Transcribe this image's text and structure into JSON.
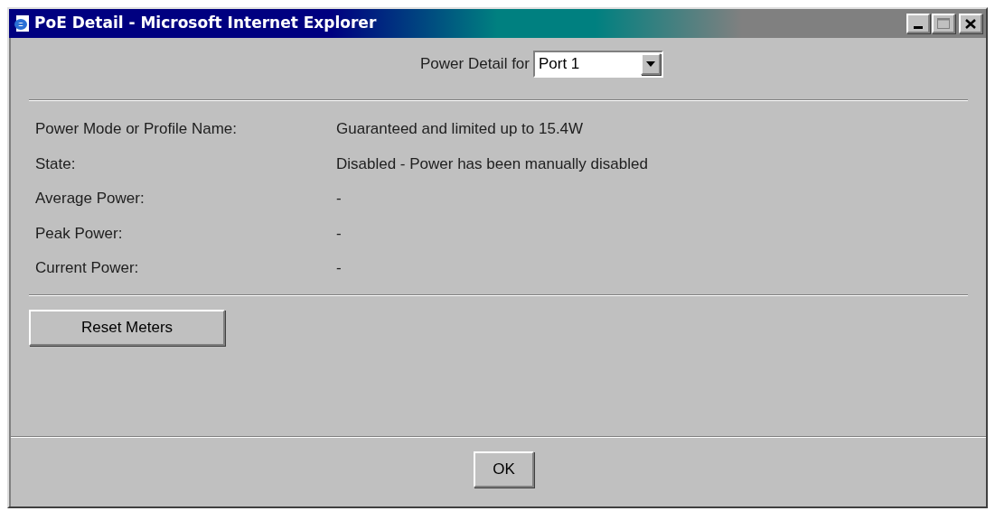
{
  "window": {
    "title": "PoE Detail - Microsoft Internet Explorer"
  },
  "selector": {
    "label": "Power Detail for",
    "value": "Port 1"
  },
  "details": [
    {
      "label": "Power Mode or Profile Name:",
      "value": "Guaranteed and limited up to 15.4W"
    },
    {
      "label": "State:",
      "value": "Disabled - Power has been manually disabled"
    },
    {
      "label": "Average Power:",
      "value": "-"
    },
    {
      "label": "Peak Power:",
      "value": "-"
    },
    {
      "label": "Current Power:",
      "value": "-"
    }
  ],
  "buttons": [
    {
      "kind": "reset",
      "label": "Reset Meters"
    },
    {
      "kind": "ok",
      "label": "OK"
    }
  ]
}
